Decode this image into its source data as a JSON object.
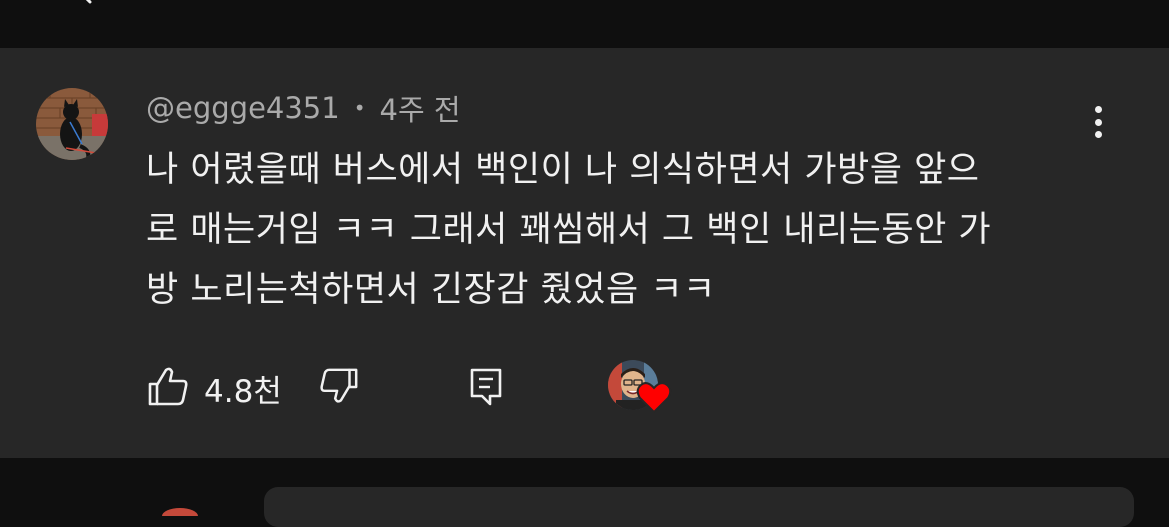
{
  "comment": {
    "author": "@eggge4351",
    "separator": "•",
    "time_ago": "4주 전",
    "text_lines": [
      "나 어렸을때 버스에서 백인이 나 의식하면서 가방을 앞으",
      "로 매는거임 ㅋㅋ 그래서 꽤씸해서 그 백인 내리는동안 가",
      "방 노리는척하면서 긴장감 줬었음 ㅋㅋ"
    ],
    "like_count": "4.8천"
  },
  "icons": {
    "more": "more-vertical-icon",
    "like": "thumbs-up-icon",
    "dislike": "thumbs-down-icon",
    "reply": "reply-comment-icon",
    "heart": "heart-icon"
  },
  "colors": {
    "background": "#0f0f0f",
    "card": "#272727",
    "text_primary": "#f1f1f1",
    "text_secondary": "#aaaaaa",
    "heart": "#ff0000"
  }
}
